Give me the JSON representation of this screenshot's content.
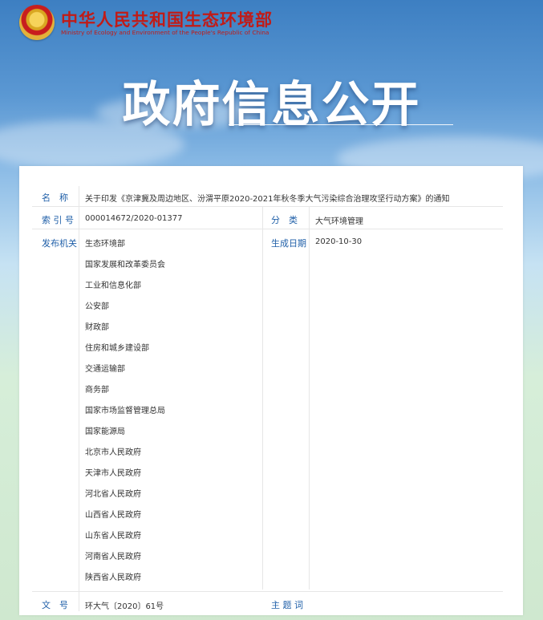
{
  "header": {
    "org_name_cn": "中华人民共和国生态环境部",
    "org_name_en": "Ministry of Ecology and Environment of the People's Republic of China",
    "logo_icon": "national-emblem-icon"
  },
  "banner": {
    "title": "政府信息公开"
  },
  "document": {
    "title_label": "名　称",
    "title_value": "关于印发《京津冀及周边地区、汾渭平原2020-2021年秋冬季大气污染综合治理攻坚行动方案》的通知",
    "index_label": "索 引 号",
    "index_value": "000014672/2020-01377",
    "category_label": "分　类",
    "category_value": "大气环境管理",
    "publisher_label": "发布机关",
    "publishers": [
      "生态环境部",
      "国家发展和改革委员会",
      "工业和信息化部",
      "公安部",
      "财政部",
      "住房和城乡建设部",
      "交通运输部",
      "商务部",
      "国家市场监督管理总局",
      "国家能源局",
      "北京市人民政府",
      "天津市人民政府",
      "河北省人民政府",
      "山西省人民政府",
      "山东省人民政府",
      "河南省人民政府",
      "陕西省人民政府"
    ],
    "date_label": "生成日期",
    "date_value": "2020-10-30",
    "doc_no_label": "文　号",
    "doc_no_value": "环大气〔2020〕61号",
    "keywords_label": "主 题 词",
    "keywords_value": ""
  }
}
